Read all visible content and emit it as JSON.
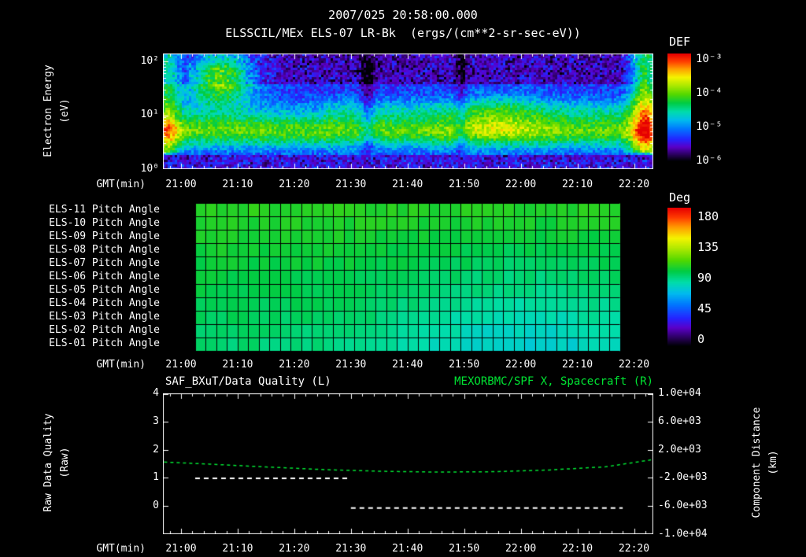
{
  "header": {
    "timestamp": "2007/025 20:58:00.000",
    "title": "ELSSCIL/MEx ELS-07 LR-Bk  (ergs/(cm**2-sr-sec-eV))"
  },
  "axes": {
    "x_label": "GMT(min)",
    "x_ticks": [
      "21:00",
      "21:10",
      "21:20",
      "21:30",
      "21:40",
      "21:50",
      "22:00",
      "22:10",
      "22:20"
    ]
  },
  "spectrogram_panel": {
    "ylabel": "Electron Energy",
    "ylabel2": "(eV)",
    "y_ticks": [
      "10²",
      "10¹",
      "10⁰"
    ],
    "colorbar": {
      "label": "DEF",
      "ticks": [
        "10⁻³",
        "10⁻⁴",
        "10⁻⁵",
        "10⁻⁶"
      ]
    }
  },
  "pitch_panel": {
    "row_labels": [
      "ELS-11 Pitch Angle",
      "ELS-10 Pitch Angle",
      "ELS-09 Pitch Angle",
      "ELS-08 Pitch Angle",
      "ELS-07 Pitch Angle",
      "ELS-06 Pitch Angle",
      "ELS-05 Pitch Angle",
      "ELS-04 Pitch Angle",
      "ELS-03 Pitch Angle",
      "ELS-02 Pitch Angle",
      "ELS-01 Pitch Angle"
    ],
    "colorbar": {
      "label": "Deg",
      "ticks": [
        "180",
        "135",
        "90",
        "45",
        "0"
      ]
    }
  },
  "bottom_panel": {
    "left_title": "SAF_BXuT/Data Quality (L)",
    "right_title": "MEXORBMC/SPF X, Spacecraft (R)",
    "right_title_color": "#00e433",
    "left_ylabel": "Raw Data Quality",
    "left_ylabel2": "(Raw)",
    "left_yticks": [
      "4",
      "3",
      "2",
      "1",
      "0"
    ],
    "right_ylabel": "Component Distance",
    "right_ylabel2": "(km)",
    "right_yticks": [
      "1.0e+04",
      "6.0e+03",
      "2.0e+03",
      "-2.0e+03",
      "-6.0e+03",
      "-1.0e+04"
    ]
  },
  "chart_data": [
    {
      "type": "heatmap",
      "name": "electron-energy-spectrogram",
      "title": "ELSSCIL/MEx ELS-07 LR-Bk",
      "units": "ergs/(cm**2-sr-sec-eV)",
      "xlabel": "GMT(min)",
      "x_ticks": [
        "21:00",
        "21:10",
        "21:20",
        "21:30",
        "21:40",
        "21:50",
        "22:00",
        "22:10",
        "22:20"
      ],
      "x_range_minutes_from_2100": [
        -3.2,
        83.3
      ],
      "ylabel": "Electron Energy (eV)",
      "y_scale": "log",
      "y_range_ev": [
        1,
        140
      ],
      "z_label": "DEF",
      "z_range": [
        1e-06,
        0.001
      ],
      "z_ticks_log10": [
        -3,
        -4,
        -5,
        -6
      ],
      "render": {
        "base": 0.22,
        "noise": 0.16,
        "top_dark_above": 0.74,
        "top_dark_amount": 0.1,
        "bottom_strip_below": 0.12,
        "bands": [
          {
            "e": 0.33,
            "es": 0.1,
            "amp": 0.4
          },
          {
            "e": 0.52,
            "es": 0.07,
            "amp": 0.14,
            "t_onset": 25
          }
        ],
        "blobs": [
          {
            "t": 7,
            "ts": 4,
            "e": 0.8,
            "es": 0.17,
            "amp": 0.5
          },
          {
            "t": -2.5,
            "ts": 1.6,
            "amp": 0.3
          },
          {
            "t": 82,
            "ts": 1.8,
            "amp": 0.42
          },
          {
            "t": 56,
            "ts": 6,
            "e": 0.45,
            "es": 0.15,
            "amp": 0.16
          },
          {
            "t": 33,
            "ts": 0.9,
            "amp": -0.14
          },
          {
            "t": 49.5,
            "ts": 0.7,
            "amp": -0.12
          }
        ]
      }
    },
    {
      "type": "heatmap",
      "name": "pitch-angle-panels",
      "rows": [
        "ELS-11",
        "ELS-10",
        "ELS-09",
        "ELS-08",
        "ELS-07",
        "ELS-06",
        "ELS-05",
        "ELS-04",
        "ELS-03",
        "ELS-02",
        "ELS-01"
      ],
      "value_label": "Deg",
      "value_range": [
        0,
        180
      ],
      "value_ticks": [
        180,
        135,
        90,
        45,
        0
      ],
      "time_extent_minutes_from_2100": [
        2.5,
        77.5
      ],
      "columns": 40,
      "typical_values_deg": "mostly 90-105 (green), dipping to ~75 (cyan) in lower rows after ~21:40",
      "render": {
        "base": 104,
        "row_step": -1.3,
        "dip": {
          "center": 0.78,
          "sigma": 0.22,
          "amp": -16
        },
        "noise": 2.5
      }
    },
    {
      "type": "line",
      "name": "quality-and-distance",
      "xlabel": "GMT(min)",
      "left_series": {
        "name": "SAF_BXuT/Data Quality (L)",
        "axis_range": [
          -1,
          4
        ],
        "style": "dashed",
        "color": "#ffffff",
        "segments": [
          {
            "t_minutes": [
              2.5,
              29.5
            ],
            "value": 1
          },
          {
            "t_minutes": [
              30,
              78
            ],
            "value": -0.06
          }
        ]
      },
      "right_series": {
        "name": "MEXORBMC/SPF X, Spacecraft (R)",
        "axis_range": [
          -10000,
          10000
        ],
        "style": "dashed",
        "color": "#00e433",
        "points_t_km": [
          [
            -3,
            250
          ],
          [
            5,
            -50
          ],
          [
            15,
            -450
          ],
          [
            25,
            -820
          ],
          [
            35,
            -1060
          ],
          [
            45,
            -1180
          ],
          [
            55,
            -1130
          ],
          [
            65,
            -880
          ],
          [
            75,
            -430
          ],
          [
            83,
            550
          ]
        ]
      }
    }
  ],
  "render": {
    "background": "#000000",
    "text_color": "#ffffff",
    "accent_green": "#00e433",
    "noise_seed": 42,
    "colormap": [
      [
        0,
        "#000006"
      ],
      [
        0.06,
        "#2b0060"
      ],
      [
        0.13,
        "#5a00c8"
      ],
      [
        0.2,
        "#2424ff"
      ],
      [
        0.3,
        "#0078ff"
      ],
      [
        0.38,
        "#00bbee"
      ],
      [
        0.46,
        "#00ddaa"
      ],
      [
        0.54,
        "#00cc44"
      ],
      [
        0.62,
        "#52d800"
      ],
      [
        0.7,
        "#a8e800"
      ],
      [
        0.78,
        "#f4f400"
      ],
      [
        0.86,
        "#ff9c00"
      ],
      [
        0.93,
        "#ff3c00"
      ],
      [
        1,
        "#e60000"
      ]
    ]
  }
}
